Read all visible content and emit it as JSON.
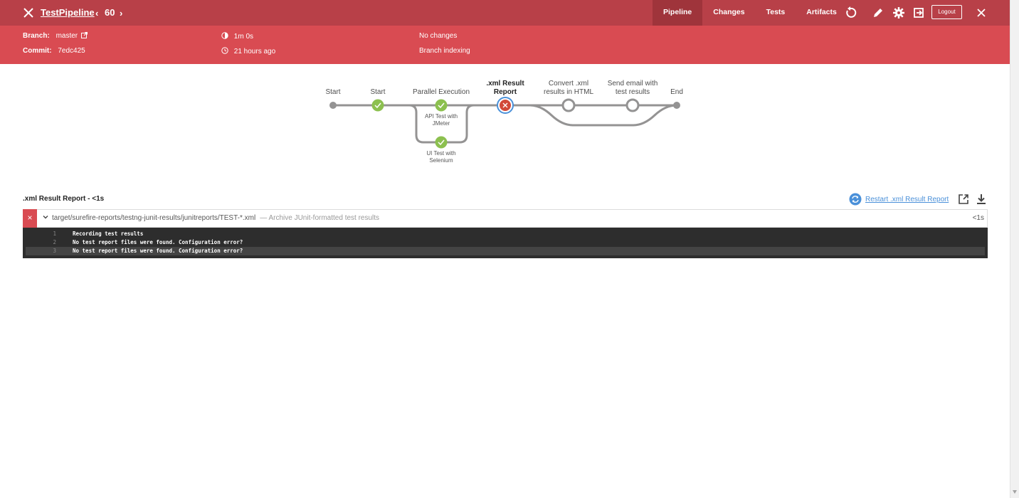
{
  "header": {
    "title": "TestPipeline",
    "run_number": "60",
    "tabs": [
      {
        "label": "Pipeline",
        "active": true
      },
      {
        "label": "Changes",
        "active": false
      },
      {
        "label": "Tests",
        "active": false
      },
      {
        "label": "Artifacts",
        "active": false
      }
    ],
    "logout_label": "Logout"
  },
  "summary": {
    "branch_label": "Branch:",
    "branch_value": "master",
    "commit_label": "Commit:",
    "commit_value": "7edc425",
    "duration": "1m 0s",
    "time_ago": "21 hours ago",
    "changes": "No changes",
    "cause": "Branch indexing"
  },
  "pipeline": {
    "stages": [
      {
        "label": "Start",
        "status": "none"
      },
      {
        "label": "Start",
        "status": "success"
      },
      {
        "label": "Parallel Execution",
        "status": "success",
        "branches": [
          {
            "label_line1": "API Test with",
            "label_line2": "JMeter",
            "status": "success"
          },
          {
            "label_line1": "UI Test with",
            "label_line2": "Selenium",
            "status": "success"
          }
        ]
      },
      {
        "label_line1": ".xml Result",
        "label_line2": "Report",
        "status": "failure",
        "selected": true
      },
      {
        "label_line1": "Convert .xml",
        "label_line2": "results in HTML",
        "status": "not_built"
      },
      {
        "label_line1": "Send email with",
        "label_line2": "test results",
        "status": "not_built"
      },
      {
        "label": "End",
        "status": "none"
      }
    ]
  },
  "stage_detail": {
    "title": ".xml Result Report - <1s",
    "restart_label": "Restart .xml Result Report",
    "step": {
      "status_glyph": "×",
      "path": "target/surefire-reports/testng-junit-results/junitreports/TEST-*.xml",
      "description": "— Archive JUnit-formatted test results",
      "duration": "<1s"
    },
    "log": [
      {
        "num": "1",
        "text": "Recording test results"
      },
      {
        "num": "2",
        "text": "No test report files were found. Configuration error?"
      },
      {
        "num": "3",
        "text": "No test report files were found. Configuration error?"
      }
    ]
  },
  "colors": {
    "header_dark": "#b84048",
    "header_light": "#d94b52",
    "success": "#8cc04f",
    "failure": "#d24939",
    "connector": "#949393",
    "link": "#4a90d9"
  }
}
